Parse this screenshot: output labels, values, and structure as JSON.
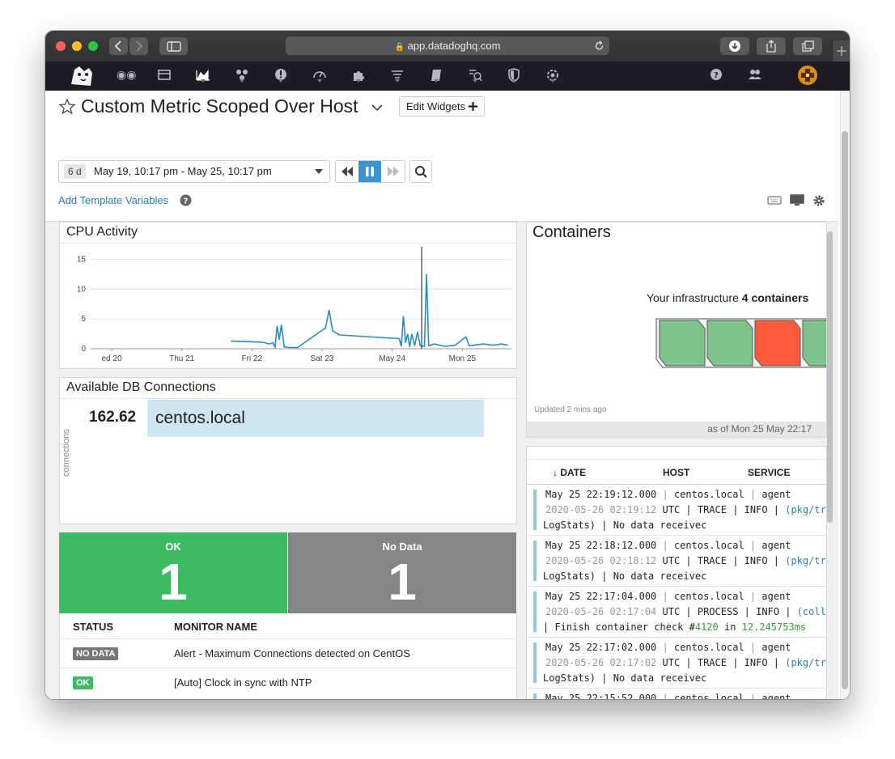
{
  "browser": {
    "url": "app.datadoghq.com"
  },
  "dashboard": {
    "title": "Custom Metric Scoped Over Host",
    "edit_widgets_label": "Edit Widgets",
    "time_badge": "6 d",
    "time_range": "May 19, 10:17 pm - May 25, 10:17 pm",
    "template_variables_label": "Add Template Variables"
  },
  "cpu_widget": {
    "title": "CPU Activity"
  },
  "chart_data": {
    "type": "line",
    "title": "CPU Activity",
    "x_ticks": [
      "ed 20",
      "Thu 21",
      "Fri 22",
      "Sat 23",
      "May 24",
      "Mon 25"
    ],
    "y_ticks": [
      "0",
      "5",
      "10",
      "15"
    ],
    "ylim": [
      0,
      16
    ],
    "series": [
      {
        "color": "#2b8cc4",
        "points": [
          [
            2.0,
            1.3
          ],
          [
            2.45,
            1.1
          ],
          [
            2.55,
            0.8
          ],
          [
            2.6,
            1.0
          ],
          [
            2.63,
            0.3
          ],
          [
            2.66,
            3.8
          ],
          [
            2.69,
            1.5
          ],
          [
            2.72,
            4.0
          ],
          [
            2.76,
            0.3
          ],
          [
            2.85,
            0.2
          ],
          [
            2.95,
            0.2
          ],
          [
            3.35,
            3.5
          ],
          [
            3.4,
            6.5
          ],
          [
            3.45,
            3.0
          ],
          [
            3.55,
            2.3
          ],
          [
            4.4,
            1.7
          ],
          [
            4.43,
            0.4
          ],
          [
            4.46,
            5.5
          ],
          [
            4.49,
            1.0
          ],
          [
            4.52,
            2.5
          ],
          [
            4.55,
            0.3
          ],
          [
            4.58,
            2.5
          ],
          [
            4.62,
            0.5
          ],
          [
            4.66,
            2.8
          ],
          [
            4.7,
            0.5
          ],
          [
            4.76,
            0.4
          ],
          [
            4.79,
            12.5
          ],
          [
            4.82,
            0.5
          ],
          [
            4.9,
            0.8
          ],
          [
            5.05,
            0.4
          ],
          [
            5.2,
            0.6
          ],
          [
            5.35,
            2.0
          ],
          [
            5.4,
            0.5
          ],
          [
            5.6,
            0.8
          ],
          [
            5.75,
            0.6
          ],
          [
            5.85,
            0.8
          ],
          [
            5.95,
            0.6
          ]
        ]
      }
    ],
    "grid": true
  },
  "db_widget": {
    "title": "Available DB Connections",
    "axis_label": "connections",
    "value": "162.62",
    "host": "centos.local"
  },
  "monitor_widget": {
    "ok_label": "OK",
    "ok_count": "1",
    "nodata_label": "No Data",
    "nodata_count": "1",
    "col_status": "STATUS",
    "col_name": "MONITOR NAME",
    "rows": [
      {
        "status": "NO DATA",
        "name": "Alert - Maximum Connections detected on CentOS"
      },
      {
        "status": "OK",
        "name": "[Auto] Clock in sync with NTP"
      }
    ]
  },
  "containers_widget": {
    "title": "Containers",
    "summary_prefix": "Your infrastructure",
    "summary_count": "4 containers",
    "updated": "Updated 2 mins ago",
    "as_of": "as of Mon 25 May 22:17",
    "colors": [
      "#7ec48a",
      "#7ec48a",
      "#ff5a3c",
      "#7ec48a"
    ]
  },
  "log_widget": {
    "col_date": "DATE",
    "col_host": "HOST",
    "col_service": "SERVICE",
    "rows": [
      {
        "date": "May 25 22:19:12.000",
        "host": "centos.local",
        "service": "agent",
        "ts": "2020-05-26 02:19:12",
        "tail": " UTC | TRACE | INFO | ",
        "link": "(pkg/trace",
        "line3": "LogStats) | No data receivec"
      },
      {
        "date": "May 25 22:18:12.000",
        "host": "centos.local",
        "service": "agent",
        "ts": "2020-05-26 02:18:12",
        "tail": " UTC | TRACE | INFO | ",
        "link": "(pkg/trace",
        "line3": "LogStats) | No data receivec"
      },
      {
        "date": "May 25 22:17:04.000",
        "host": "centos.local",
        "service": "agent",
        "ts": "2020-05-26 02:17:04",
        "tail": " UTC | PROCESS | INFO | ",
        "link": "(collect",
        "line3": " | Finish container check #",
        "num1": "4120",
        "mid": " in ",
        "num2": "12.245753ms"
      },
      {
        "date": "May 25 22:17:02.000",
        "host": "centos.local",
        "service": "agent",
        "ts": "2020-05-26 02:17:02",
        "tail": " UTC | TRACE | INFO | ",
        "link": "(pkg/trace",
        "line3": "LogStats) | No data receivec"
      },
      {
        "date": "May 25 22:15:52.000",
        "host": "centos.local",
        "service": "agent"
      }
    ]
  }
}
